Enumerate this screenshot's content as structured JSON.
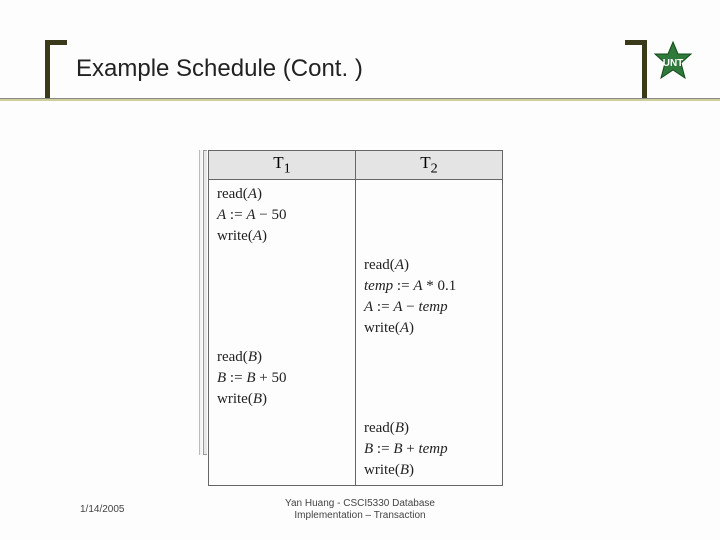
{
  "title": "Example Schedule (Cont. )",
  "logo_label": "UNT",
  "schedule": {
    "headers": {
      "t1": "T",
      "t1_sub": "1",
      "t2": "T",
      "t2_sub": "2"
    },
    "rows": [
      {
        "t1": "read(A)\nA := A − 50\nwrite(A)",
        "t2": ""
      },
      {
        "t1": "",
        "t2": "read(A)\ntemp := A * 0.1\nA := A −  temp\nwrite(A)"
      },
      {
        "t1": "read(B)\nB := B + 50\nwrite(B)",
        "t2": ""
      },
      {
        "t1": "",
        "t2": "read(B)\nB := B + temp\nwrite(B)"
      }
    ]
  },
  "footer": {
    "date": "1/14/2005",
    "line1": "Yan Huang - CSCI5330 Database",
    "line2": "Implementation – Transaction"
  }
}
